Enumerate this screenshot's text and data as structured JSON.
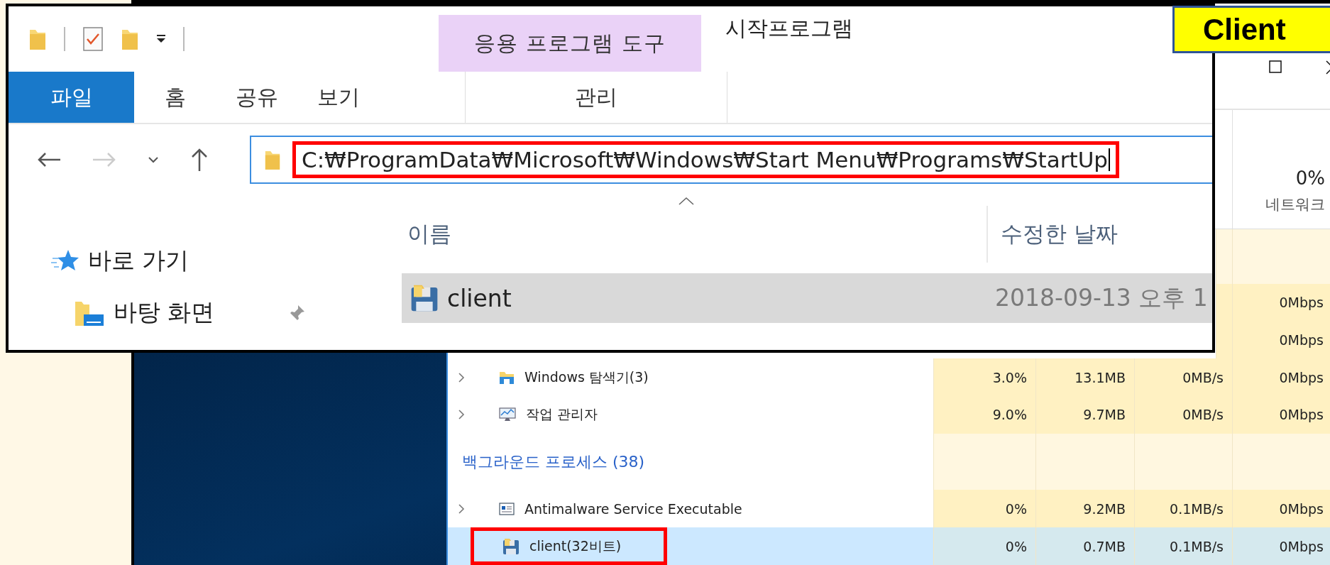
{
  "label": {
    "text": "Client"
  },
  "task_manager": {
    "header": {
      "percent": "0%",
      "label": "네트워크"
    },
    "rows": [
      {
        "kind": "covered",
        "network": "0Mbps"
      },
      {
        "kind": "covered",
        "network": "0Mbps"
      },
      {
        "kind": "explorer",
        "name": "Windows 탐색기(3)",
        "expandable": true,
        "selected": false,
        "highlighted": false,
        "cpu": "3.0%",
        "memory": "13.1MB",
        "disk": "0MB/s",
        "network": "0Mbps"
      },
      {
        "kind": "taskmgr",
        "name": "작업 관리자",
        "expandable": true,
        "selected": false,
        "highlighted": false,
        "cpu": "9.0%",
        "memory": "9.7MB",
        "disk": "0MB/s",
        "network": "0Mbps"
      },
      {
        "kind": "section",
        "name": "백그라운드 프로세스 (38)"
      },
      {
        "kind": "service",
        "name": "Antimalware Service Executable",
        "expandable": true,
        "selected": false,
        "highlighted": false,
        "cpu": "0%",
        "memory": "9.2MB",
        "disk": "0.1MB/s",
        "network": "0Mbps"
      },
      {
        "kind": "app",
        "name": "client(32비트)",
        "expandable": false,
        "selected": true,
        "highlighted": true,
        "cpu": "0%",
        "memory": "0.7MB",
        "disk": "0.1MB/s",
        "network": "0Mbps"
      }
    ]
  },
  "explorer": {
    "title": "시작프로그램",
    "context_group": "응용 프로그램 도구",
    "tabs": [
      {
        "label": "파일",
        "kind": "file"
      },
      {
        "label": "홈",
        "kind": "normal"
      },
      {
        "label": "공유",
        "kind": "normal"
      },
      {
        "label": "보기",
        "kind": "normal"
      },
      {
        "label": "관리",
        "kind": "context"
      }
    ],
    "address": {
      "value": "C:₩ProgramData₩Microsoft₩Windows₩Start Menu₩Programs₩StartUp",
      "highlighted": true,
      "focused": true
    },
    "nav": [
      {
        "label": "바로 가기",
        "kind": "quick",
        "pinned": false
      },
      {
        "label": "바탕 화면",
        "kind": "desktop",
        "pinned": true
      }
    ],
    "columns": [
      "이름",
      "수정한 날짜"
    ],
    "files": [
      {
        "name": "client",
        "modified": "2018-09-13 오후 1",
        "selected": true
      }
    ]
  }
}
